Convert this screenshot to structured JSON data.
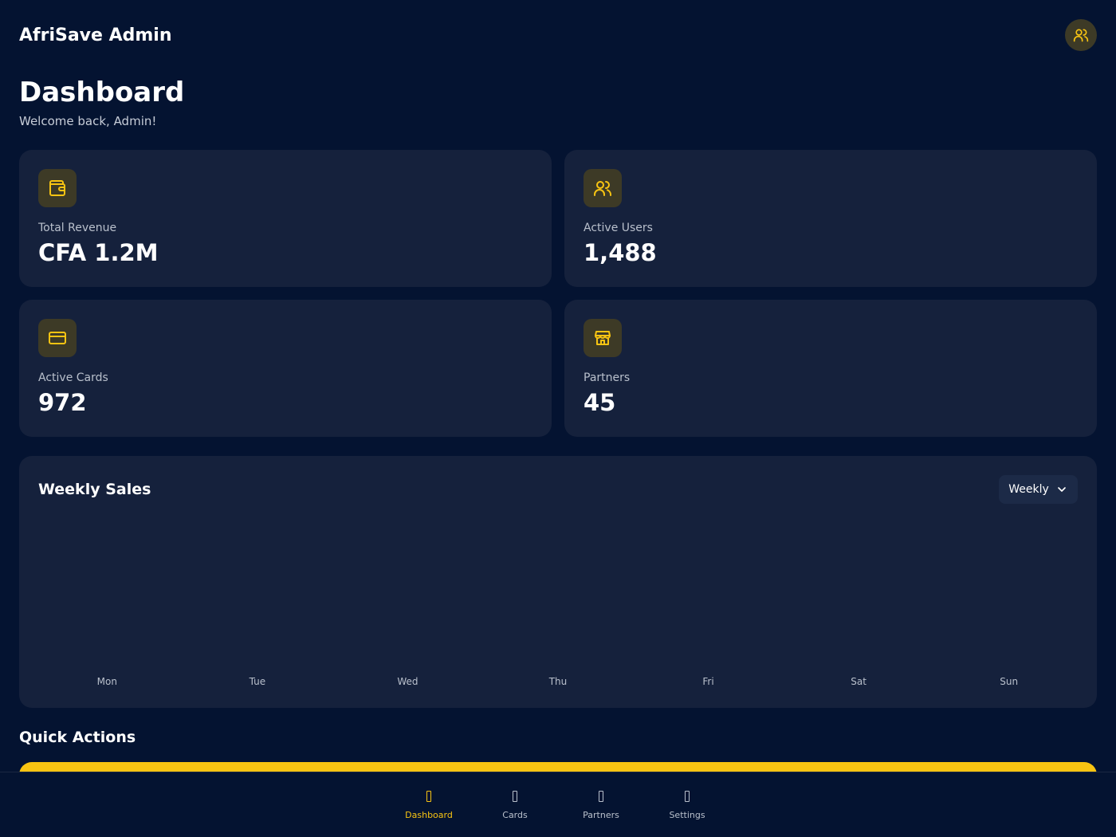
{
  "app": {
    "title": "AfriSave Admin",
    "accent": "#f8c412",
    "background": "#041331"
  },
  "header": {
    "avatar_icon": "users-icon"
  },
  "page": {
    "title": "Dashboard",
    "subtitle": "Welcome back, Admin!"
  },
  "stats": [
    {
      "label": "Total Revenue",
      "value": "CFA 1.2M",
      "icon": "wallet-icon"
    },
    {
      "label": "Active Users",
      "value": "1,488",
      "icon": "users-icon"
    },
    {
      "label": "Active Cards",
      "value": "972",
      "icon": "credit-card-icon"
    },
    {
      "label": "Partners",
      "value": "45",
      "icon": "store-icon"
    }
  ],
  "sales": {
    "title": "Weekly Sales",
    "period": "Weekly",
    "days": [
      "Mon",
      "Tue",
      "Wed",
      "Thu",
      "Fri",
      "Sat",
      "Sun"
    ]
  },
  "quick_actions": {
    "title": "Quick Actions"
  },
  "nav": [
    {
      "label": "Dashboard",
      "active": true
    },
    {
      "label": "Cards",
      "active": false
    },
    {
      "label": "Partners",
      "active": false
    },
    {
      "label": "Settings",
      "active": false
    }
  ]
}
